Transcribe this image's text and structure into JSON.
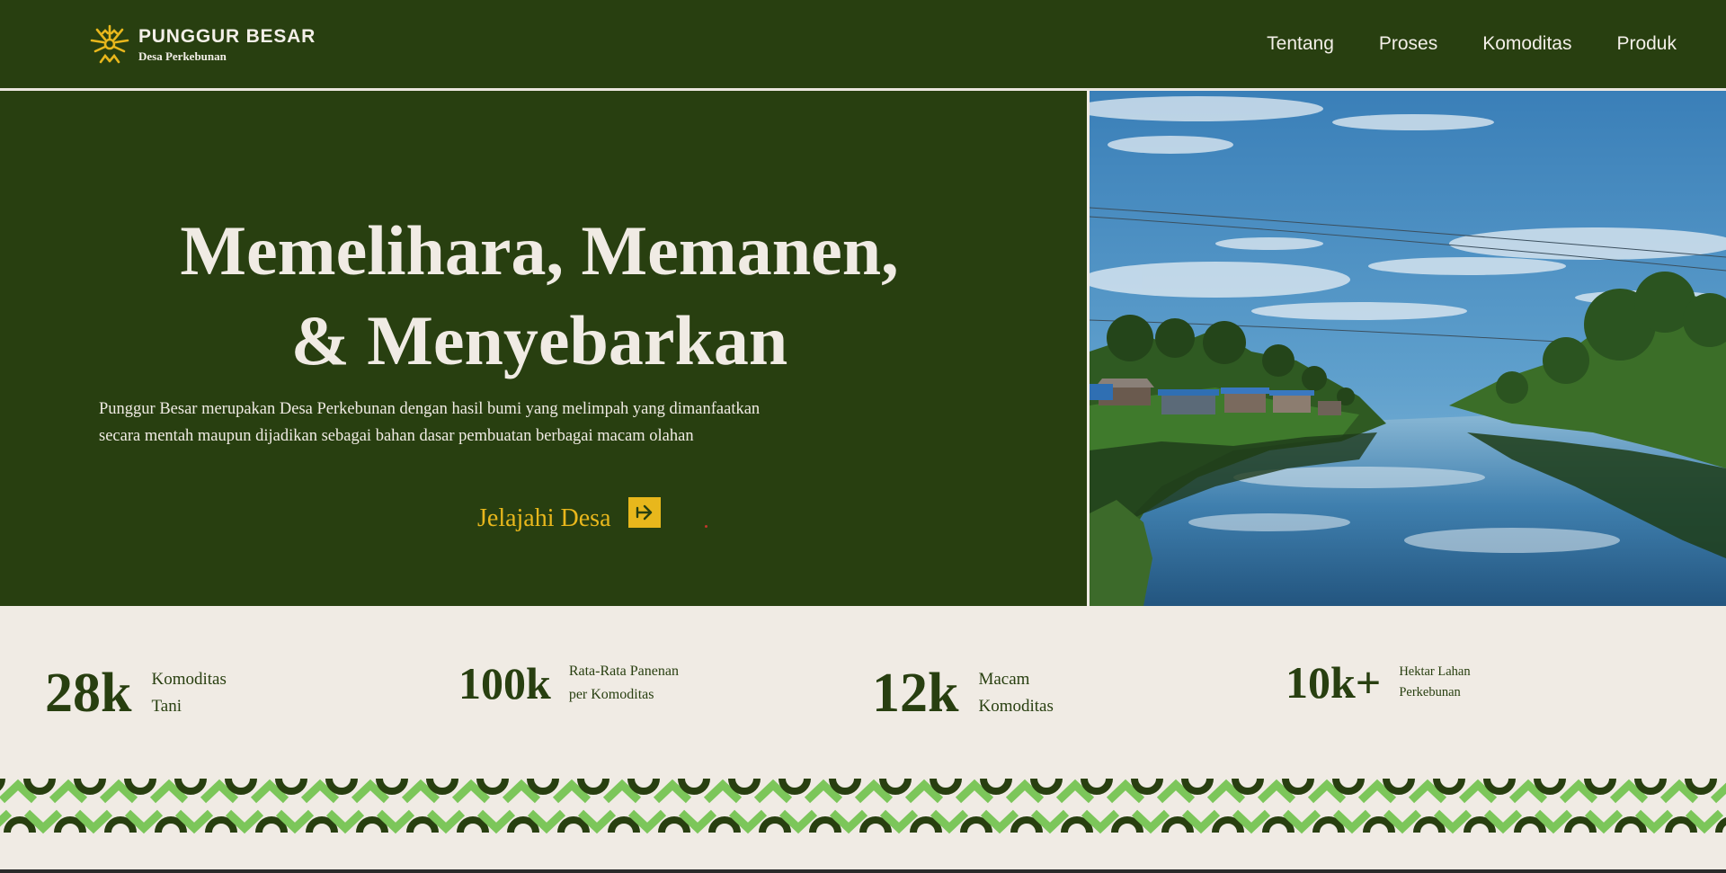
{
  "brand": {
    "name": "PUNGGUR BESAR",
    "tagline": "Desa Perkebunan",
    "logo_icon": "sun-leaf-icon",
    "accent_color": "#e8b71c"
  },
  "nav": {
    "items": [
      {
        "label": "Tentang"
      },
      {
        "label": "Proses"
      },
      {
        "label": "Komoditas"
      },
      {
        "label": "Produk"
      }
    ]
  },
  "hero": {
    "title_line1": "Memelihara, Memanen,",
    "title_line2": "& Menyebarkan",
    "description_line1": "Punggur Besar merupakan Desa Perkebunan dengan hasil bumi yang melimpah yang dimanfaatkan",
    "description_line2": "secara mentah maupun dijadikan sebagai bahan dasar pembuatan berbagai macam olahan",
    "cta_label": "Jelajahi Desa",
    "cta_icon": "arrow-right-icon",
    "background_color": "#283f10"
  },
  "stats": [
    {
      "value": "28k",
      "label_line1": "Komoditas",
      "label_line2": "Tani"
    },
    {
      "value": "100k",
      "label_line1": "Rata-Rata Panenan",
      "label_line2": "per Komoditas"
    },
    {
      "value": "12k",
      "label_line1": "Macam",
      "label_line2": "Komoditas"
    },
    {
      "value": "10k+",
      "label_line1": "Hektar Lahan",
      "label_line2": "Perkebunan"
    }
  ],
  "colors": {
    "dark_green": "#283f10",
    "light_green": "#7cc65a",
    "cream": "#f0ebe4",
    "gold": "#e8b71c"
  }
}
